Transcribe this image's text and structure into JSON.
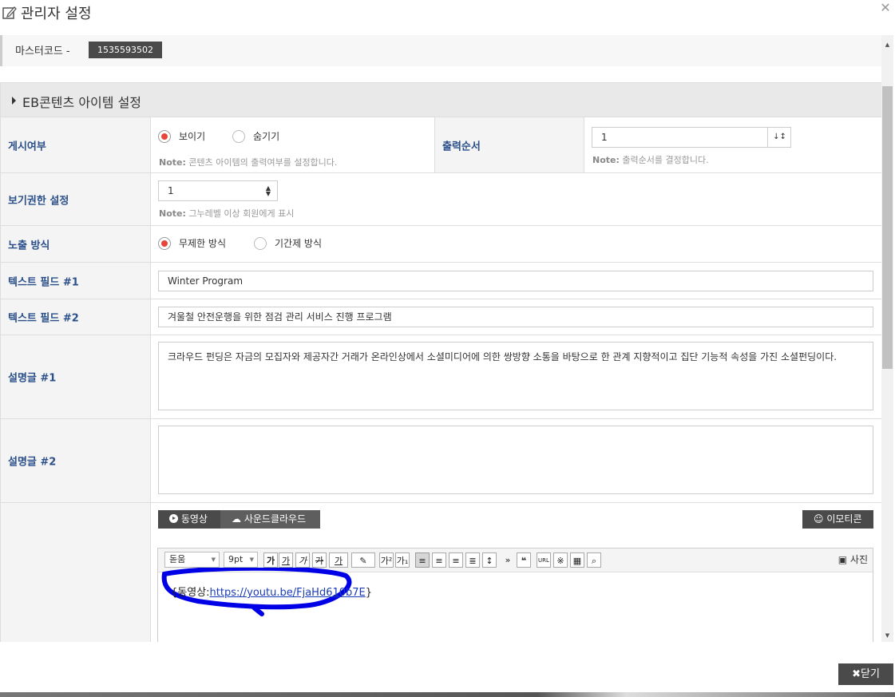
{
  "modal": {
    "title": "관리자 설정",
    "close_icon": "close-icon"
  },
  "master": {
    "label": "마스터코드 -",
    "code": "1535593502"
  },
  "section": {
    "title": "EB콘텐츠 아이템 설정"
  },
  "rows": {
    "visibility": {
      "label": "게시여부",
      "options": [
        "보이기",
        "숨기기"
      ],
      "selected": "보이기",
      "note_prefix": "Note:",
      "note": "콘텐츠 아이템의 출력여부를 설정합니다."
    },
    "order": {
      "label": "출력순서",
      "value": "1",
      "note_prefix": "Note:",
      "note": "출력순서를 결정합니다."
    },
    "permission": {
      "label": "보기권한 설정",
      "value": "1",
      "note_prefix": "Note:",
      "note": "그누레벨 이상 회원에게 표시"
    },
    "exposure": {
      "label": "노출 방식",
      "options": [
        "무제한 방식",
        "기간제 방식"
      ],
      "selected": "무제한 방식"
    },
    "text1": {
      "label": "텍스트 필드 #1",
      "value": "Winter Program"
    },
    "text2": {
      "label": "텍스트 필드 #2",
      "value": "겨울철 안전운행을 위한 점검 관리 서비스 진행 프로그램"
    },
    "desc1": {
      "label": "설명글 #1",
      "value": "크라우드 펀딩은 자금의 모집자와 제공자간 거래가 온라인상에서 소셜미디어에 의한 쌍방향 소통을 바탕으로 한 관계 지향적이고 집단 기능적 속성을 가진 소셜펀딩이다."
    },
    "desc2": {
      "label": "설명글 #2",
      "value": ""
    }
  },
  "media": {
    "video_label": "동영상",
    "sound_label": "사운드클라우드",
    "emoticon_label": "이모티콘"
  },
  "editor": {
    "font": "돋움",
    "size": "9pt",
    "photo_label": "사진",
    "content_prefix": "{동영상:",
    "content_link": "https://youtu.be/FjaHd610b7E",
    "content_suffix": "}"
  },
  "footer": {
    "close_label": "닫기"
  },
  "colors": {
    "accent_label": "#2a4f8a",
    "radio_on": "#e8463c",
    "dark_button": "#4a4a4a",
    "annotation": "#0000e6"
  }
}
